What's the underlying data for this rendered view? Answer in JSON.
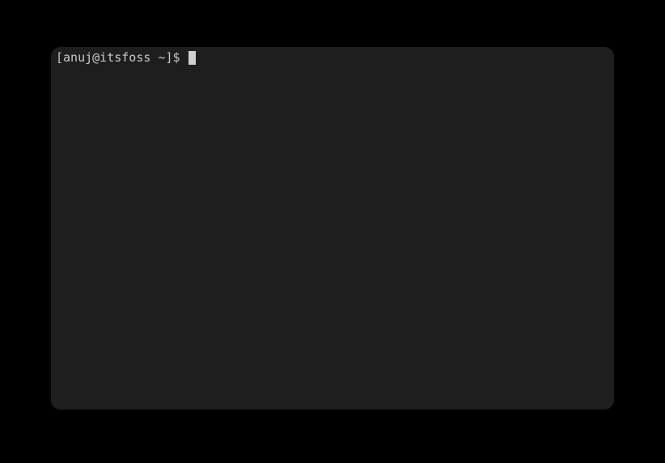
{
  "terminal": {
    "prompt": "[anuj@itsfoss ~]$ "
  }
}
